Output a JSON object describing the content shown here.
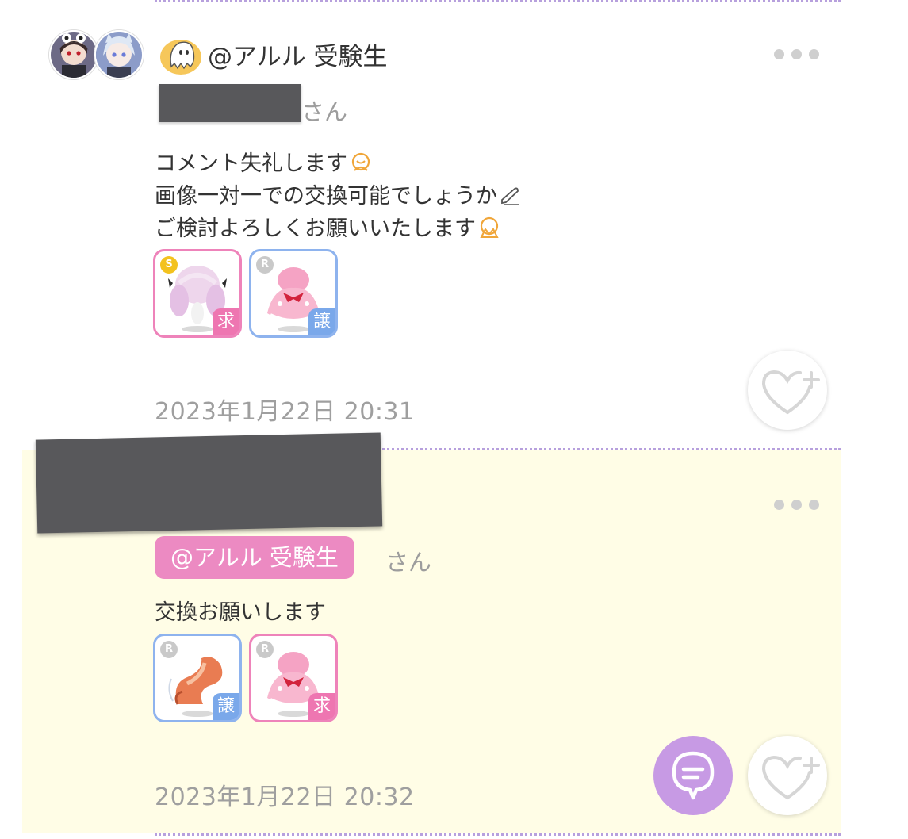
{
  "post1": {
    "username": "@アルル 受験生",
    "addressee_suffix": "さん",
    "message_lines": [
      "コメント失礼します",
      "画像一対一での交換可能でしょうか",
      "ご検討よろしくお願いいたします"
    ],
    "items": [
      {
        "name": "pink-twin-hair",
        "rarity": "S",
        "tag": "求",
        "border": "#ee83ba"
      },
      {
        "name": "pink-bow-dress",
        "rarity": "R",
        "tag": "譲",
        "border": "#8eb3ee"
      }
    ],
    "timestamp": "2023年1月22日 20:31"
  },
  "post2": {
    "mention": "@アルル 受験生",
    "addressee_suffix": "さん",
    "message": "交換お願いします",
    "items": [
      {
        "name": "orange-wing-accessory",
        "rarity": "R",
        "tag": "譲",
        "border": "#8eb3ee"
      },
      {
        "name": "pink-bow-dress",
        "rarity": "R",
        "tag": "求",
        "border": "#ee83ba"
      }
    ],
    "timestamp": "2023年1月22日 20:32"
  },
  "icons": {
    "more": "ellipsis-icon",
    "like": "heart-plus-icon",
    "comment": "comment-bubble-icon",
    "badge": "ghost-badge-icon"
  },
  "colors": {
    "want_tag": "#ee76b1",
    "give_tag": "#7aa8ea",
    "mention_pill": "#ec8ac2",
    "highlight_bg": "#fffde6",
    "comment_button": "#c79ae4",
    "divider": "#b7a0dd"
  }
}
